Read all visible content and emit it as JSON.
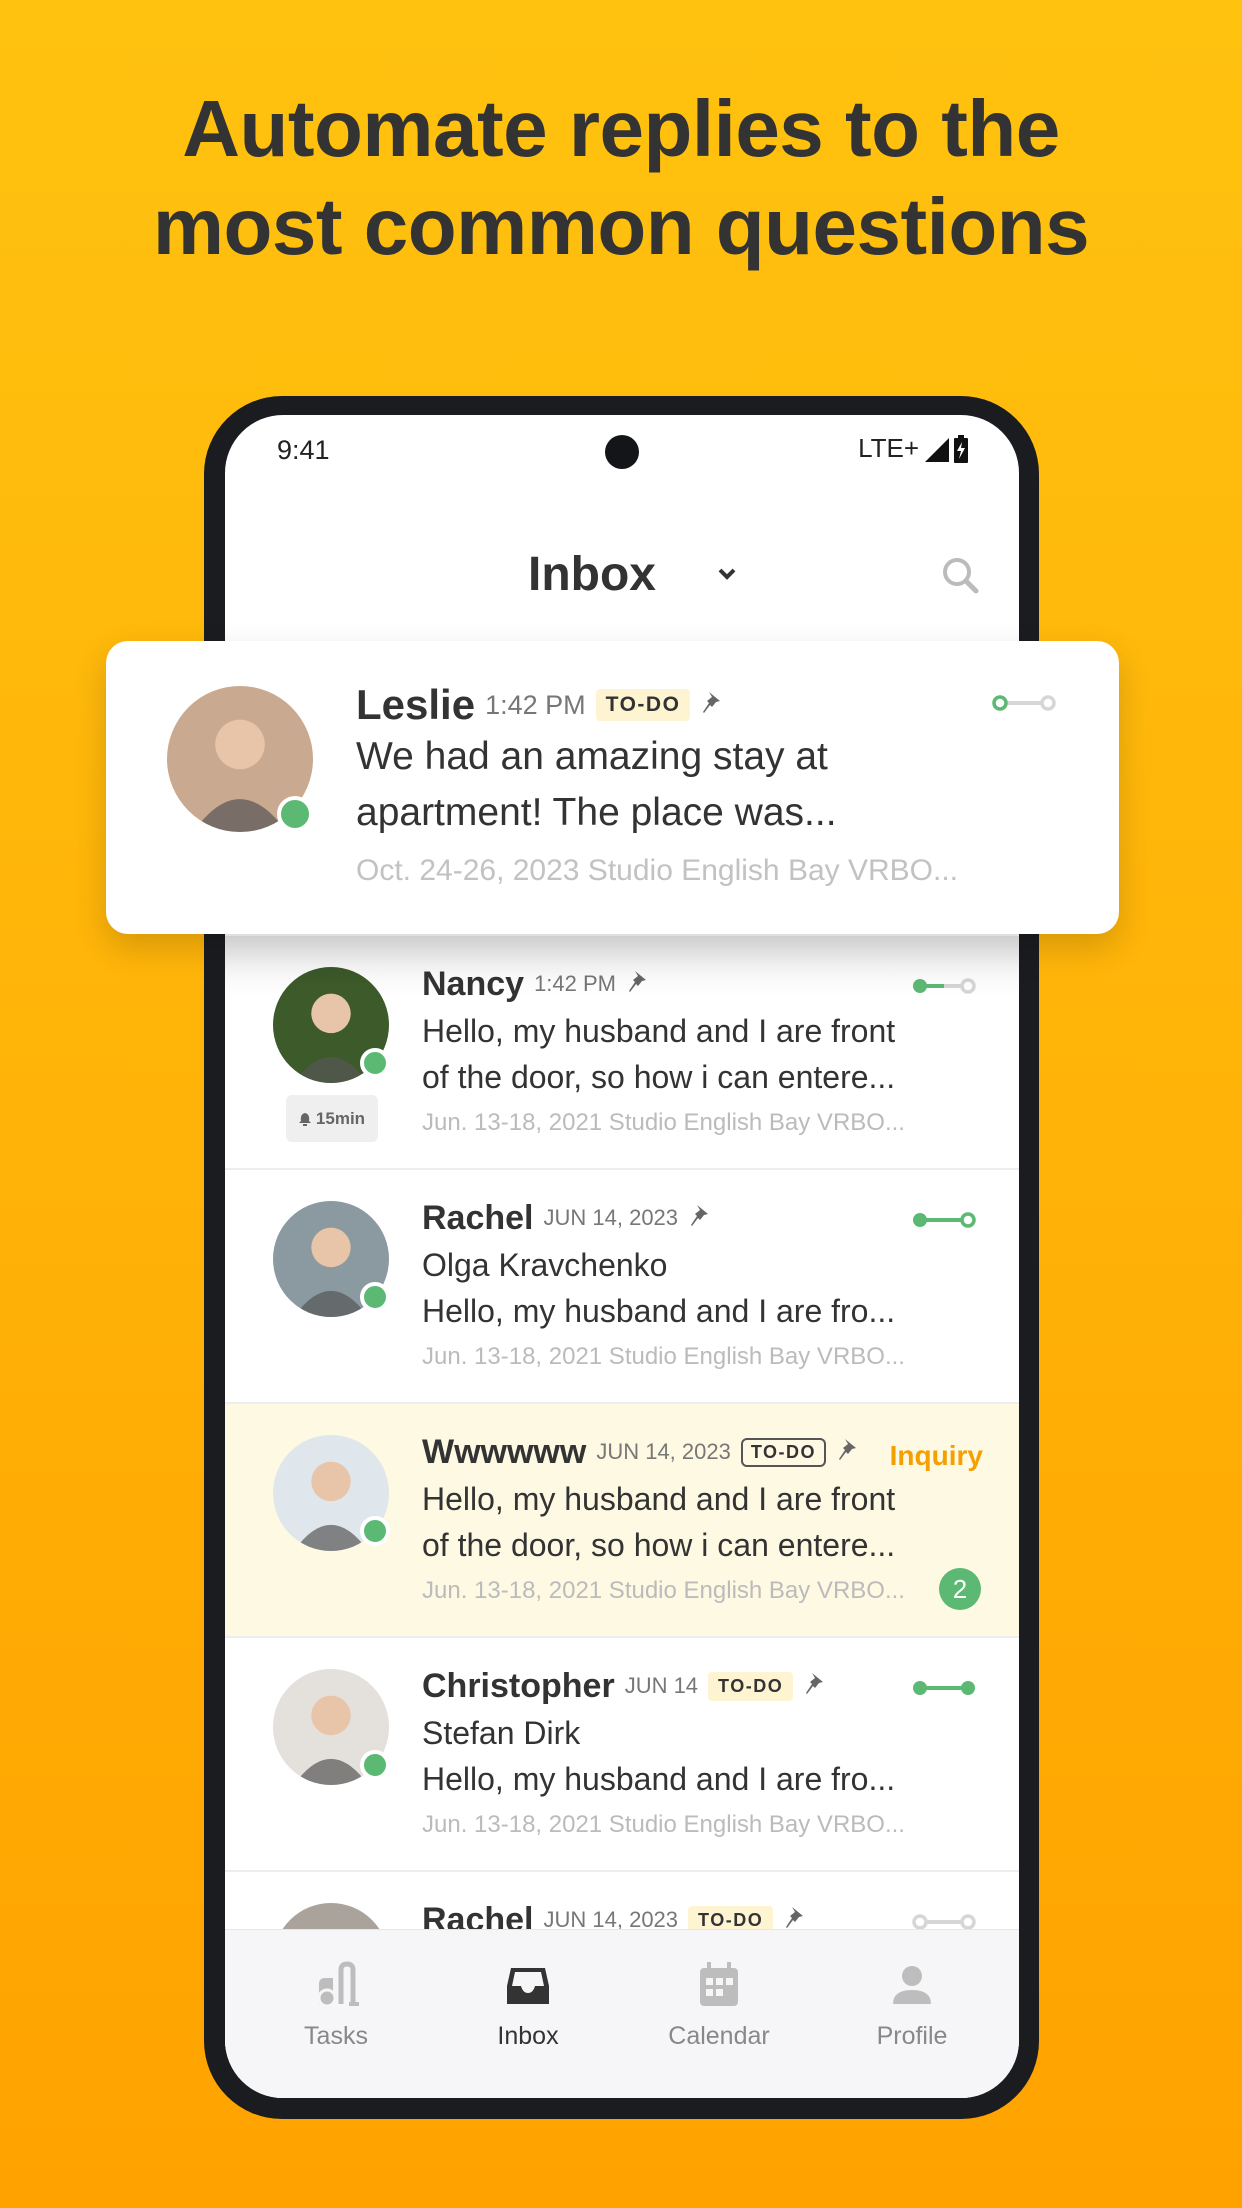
{
  "headline": {
    "line1": "Automate replies to the",
    "line2": "most common questions"
  },
  "status_bar": {
    "time": "9:41",
    "network": "LTE+",
    "signal_icon": "signal-icon",
    "battery_icon": "battery-charging-icon"
  },
  "header": {
    "title": "Inbox",
    "dropdown_icon": "chevron-down-icon",
    "search_icon": "search-icon"
  },
  "featured": {
    "name": "Leslie",
    "time": "1:42 PM",
    "tag": "TO-DO",
    "line1": "We had an amazing stay at",
    "line2": "apartment! The place was...",
    "meta": "Oct. 24-26, 2023 Studio English Bay VRBO...",
    "progress": "step1",
    "online": true,
    "avatar_color": "#c9a98f"
  },
  "conversations": [
    {
      "name": "Nancy",
      "time": "1:42 PM",
      "tag": "",
      "lines": [
        "Hello, my husband and I are front",
        "of the door, so how i can entere..."
      ],
      "meta": "Jun. 13-18, 2021 Studio English Bay VRBO...",
      "progress": "step2",
      "snooze": "15min",
      "avatar_color": "#3d5a2a"
    },
    {
      "name": "Rachel",
      "time": "JUN 14, 2023",
      "tag": "",
      "lines": [
        "Olga Kravchenko",
        "Hello, my husband and I are fro..."
      ],
      "meta": "Jun. 13-18, 2021 Studio English Bay VRBO...",
      "progress": "step3",
      "avatar_color": "#8a9aa0"
    },
    {
      "name": "Wwwwww",
      "time": "JUN 14, 2023",
      "tag": "TO-DO",
      "tag_style": "outline",
      "label": "Inquiry",
      "highlight": true,
      "unread": "2",
      "lines": [
        "Hello, my husband and I are front",
        "of the door, so how i can entere..."
      ],
      "meta": "Jun. 13-18, 2021 Studio English Bay VRBO...",
      "progress": "none",
      "avatar_color": "#dfe6ec"
    },
    {
      "name": "Christopher",
      "time": "JUN 14",
      "tag": "TO-DO",
      "lines": [
        "Stefan Dirk",
        "Hello, my husband and I are fro..."
      ],
      "meta": "Jun. 13-18, 2021 Studio English Bay VRBO...",
      "progress": "step4",
      "avatar_color": "#e4e0dc"
    },
    {
      "name": "Rachel",
      "time": "JUN 14, 2023",
      "tag": "TO-DO",
      "lines": [],
      "meta": "",
      "progress": "step0",
      "avatar_color": "#a9a39c"
    }
  ],
  "tabs": [
    {
      "label": "Tasks",
      "icon": "vacuum-icon",
      "active": false
    },
    {
      "label": "Inbox",
      "icon": "inbox-icon",
      "active": true
    },
    {
      "label": "Calendar",
      "icon": "calendar-icon",
      "active": false
    },
    {
      "label": "Profile",
      "icon": "profile-icon",
      "active": false
    }
  ],
  "colors": {
    "accent": "#FFB308",
    "green": "#5bb974",
    "inquiry": "#F5A000",
    "highlight_row": "#FEF9E3",
    "todo_bg": "#FEF4D2"
  }
}
